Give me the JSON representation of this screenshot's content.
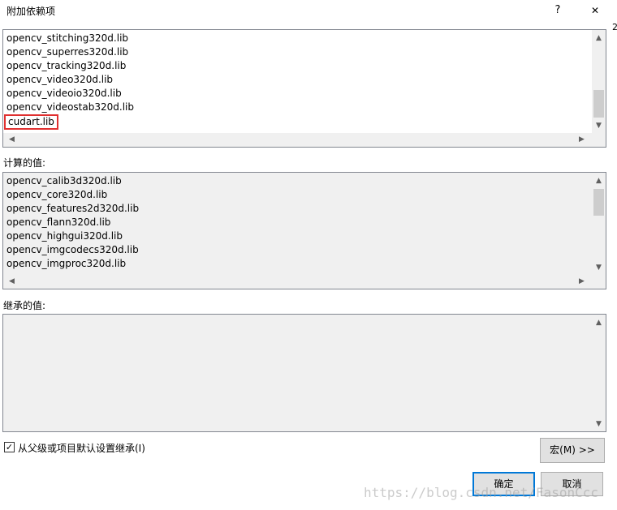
{
  "window": {
    "title": "附加依赖项",
    "help_label": "?",
    "close_label": "✕",
    "edge_glyph": "2"
  },
  "edit_list": {
    "items": [
      "opencv_stitching320d.lib",
      "opencv_superres320d.lib",
      "opencv_tracking320d.lib",
      "opencv_video320d.lib",
      "opencv_videoio320d.lib",
      "opencv_videostab320d.lib",
      "cudart.lib"
    ],
    "highlight_color": "#e03030"
  },
  "computed": {
    "label": "计算的值:",
    "items": [
      "opencv_calib3d320d.lib",
      "opencv_core320d.lib",
      "opencv_features2d320d.lib",
      "opencv_flann320d.lib",
      "opencv_highgui320d.lib",
      "opencv_imgcodecs320d.lib",
      "opencv_imgproc320d.lib"
    ]
  },
  "inherited": {
    "label": "继承的值:"
  },
  "inherit_checkbox": {
    "label": "从父级或项目默认设置继承(I)",
    "checked": true,
    "check_glyph": "✓"
  },
  "buttons": {
    "macros": "宏(M) >>",
    "ok": "确定",
    "cancel": "取消"
  },
  "scroll_glyphs": {
    "up": "▲",
    "down": "▼",
    "left": "◀",
    "right": "▶"
  },
  "watermark": "https://blog.csdn.net/FasonCcc",
  "colors": {
    "accent": "#0078d7"
  }
}
